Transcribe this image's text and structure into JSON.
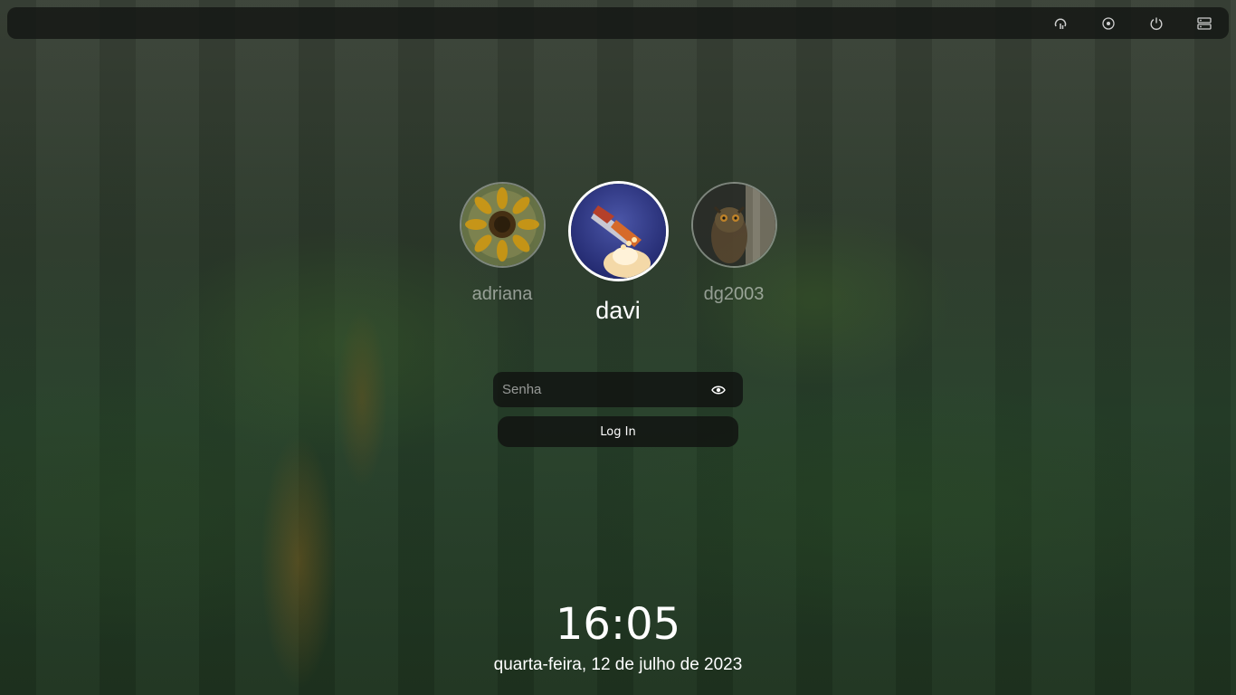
{
  "topbar": {
    "tray": [
      {
        "icon": "accessibility-icon"
      },
      {
        "icon": "session-icon"
      },
      {
        "icon": "power-icon"
      },
      {
        "icon": "keyboard-layout-icon"
      }
    ]
  },
  "users": [
    {
      "name": "adriana",
      "avatar": "sunflower",
      "selected": false
    },
    {
      "name": "davi",
      "avatar": "space-shuttle",
      "selected": true
    },
    {
      "name": "dg2003",
      "avatar": "owl",
      "selected": false
    }
  ],
  "login": {
    "password_placeholder": "Senha",
    "password_value": "",
    "reveal_icon": "eye-icon",
    "button_label": "Log In"
  },
  "clock": {
    "time": "16:05",
    "date": "quarta-feira, 12 de julho de 2023"
  },
  "colors": {
    "panel": "#141614",
    "text": "#ffffff"
  }
}
